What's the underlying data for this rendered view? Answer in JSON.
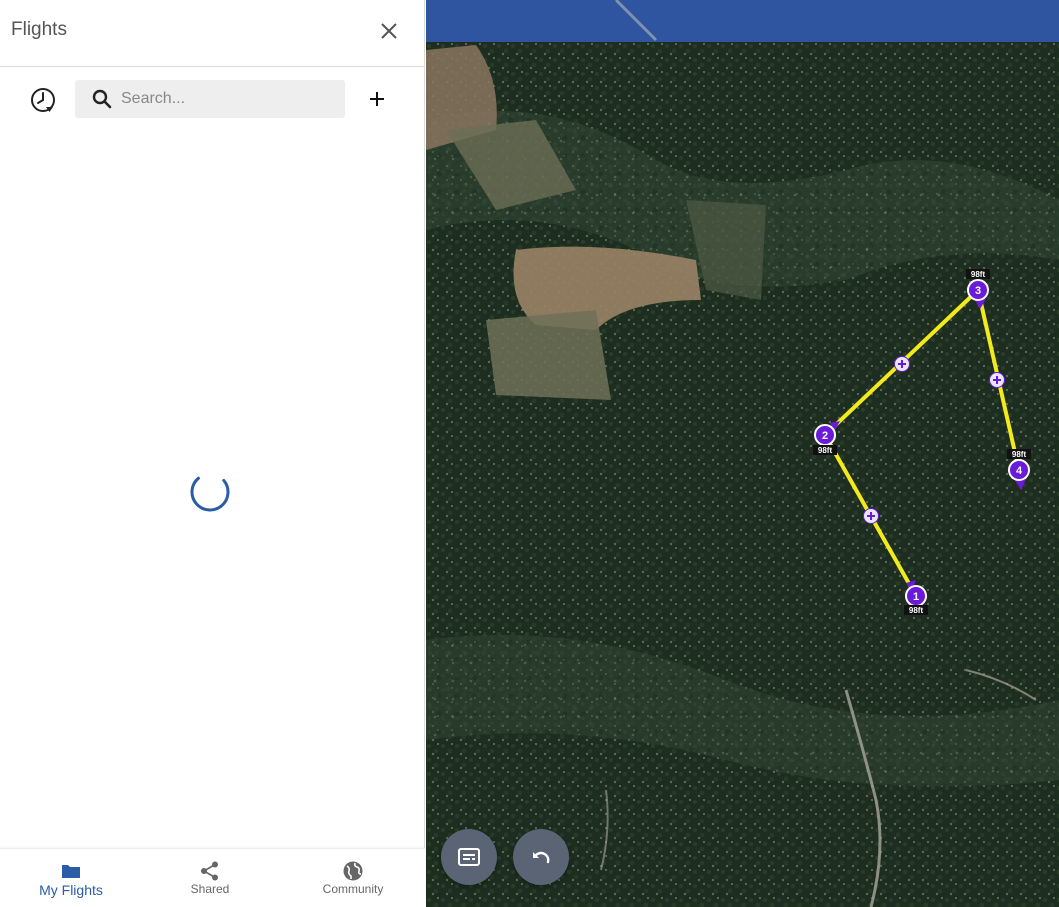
{
  "panel": {
    "title": "Flights",
    "close_icon": "close-icon",
    "history_icon": "history-clock-icon",
    "add_icon": "plus-icon",
    "search": {
      "placeholder": "Search...",
      "value": ""
    },
    "loading": true
  },
  "bottom_nav": {
    "items": [
      {
        "label": "My Flights",
        "icon": "folder-icon",
        "active": true
      },
      {
        "label": "Shared",
        "icon": "share-icon",
        "active": false
      },
      {
        "label": "Community",
        "icon": "globe-icon",
        "active": false
      }
    ]
  },
  "map": {
    "waypoints": [
      {
        "number": "1",
        "altitude": "98ft"
      },
      {
        "number": "2",
        "altitude": "98ft"
      },
      {
        "number": "3",
        "altitude": "98ft"
      },
      {
        "number": "4",
        "altitude": "98ft"
      }
    ],
    "route_color": "#f2ea1a",
    "waypoint_color": "#6a1ad8",
    "buttons": [
      {
        "name": "caption-toggle-button",
        "icon": "subtitles-icon"
      },
      {
        "name": "undo-button",
        "icon": "undo-icon"
      }
    ]
  },
  "colors": {
    "accent": "#2a5ca8",
    "map_sky": "#2f55a0"
  }
}
